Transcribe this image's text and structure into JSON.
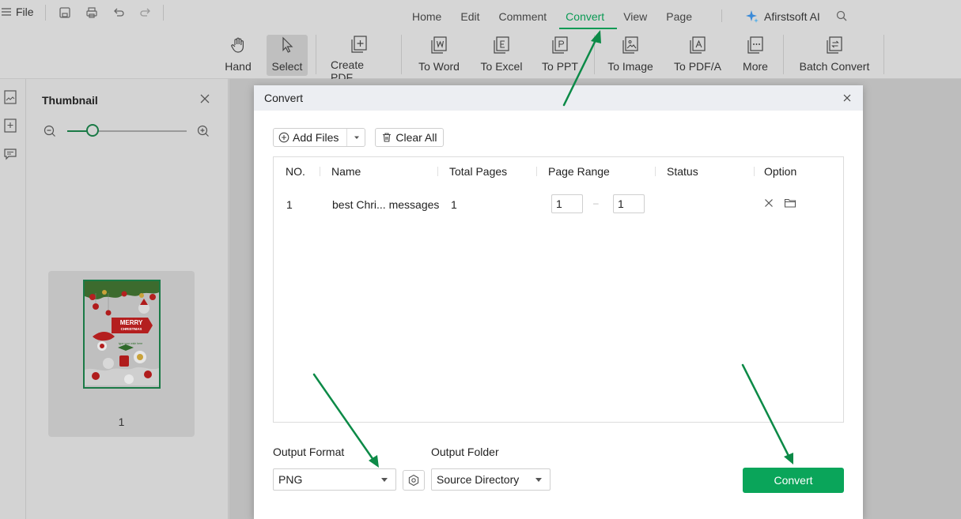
{
  "menubar": {
    "file_label": "File",
    "quick_icons": [
      "save-icon",
      "print-icon",
      "undo-icon",
      "redo-icon"
    ],
    "tabs": [
      {
        "label": "Home",
        "active": false
      },
      {
        "label": "Edit",
        "active": false
      },
      {
        "label": "Comment",
        "active": false
      },
      {
        "label": "Convert",
        "active": true
      },
      {
        "label": "View",
        "active": false
      },
      {
        "label": "Page",
        "active": false
      }
    ],
    "ai_label": "Afirstsoft AI"
  },
  "toolbar": {
    "tools": [
      {
        "label": "Hand",
        "icon": "hand-icon",
        "selected": false
      },
      {
        "label": "Select",
        "icon": "cursor-icon",
        "selected": true
      },
      {
        "label": "Create PDF",
        "icon": "create-pdf-icon",
        "selected": false
      },
      {
        "label": "To Word",
        "icon": "to-word-icon",
        "selected": false
      },
      {
        "label": "To Excel",
        "icon": "to-excel-icon",
        "selected": false
      },
      {
        "label": "To PPT",
        "icon": "to-ppt-icon",
        "selected": false
      },
      {
        "label": "To Image",
        "icon": "to-image-icon",
        "selected": false
      },
      {
        "label": "To PDF/A",
        "icon": "to-pdfa-icon",
        "selected": false
      },
      {
        "label": "More",
        "icon": "more-icon",
        "selected": false
      },
      {
        "label": "Batch Convert",
        "icon": "batch-convert-icon",
        "selected": false
      }
    ]
  },
  "thumbnail_panel": {
    "title": "Thumbnail",
    "zoom_fraction": 0.21,
    "pages": [
      {
        "number": "1",
        "card_title": "MERRY",
        "card_subtitle": "CHRISTMAS",
        "card_note": "type your wish here"
      }
    ]
  },
  "dialog": {
    "title": "Convert",
    "add_files_label": "Add Files",
    "clear_all_label": "Clear All",
    "columns": [
      "NO.",
      "Name",
      "Total Pages",
      "Page Range",
      "Status",
      "Option"
    ],
    "rows": [
      {
        "no": "1",
        "name": "best Chri... messages",
        "total_pages": "1",
        "range_from": "1",
        "range_to": "1",
        "status": ""
      }
    ],
    "output_format_label": "Output Format",
    "output_format_value": "PNG",
    "output_folder_label": "Output Folder",
    "output_folder_value": "Source Directory",
    "convert_label": "Convert"
  },
  "colors": {
    "accent": "#0aa55a",
    "annotation_arrow": "#0c8a47"
  }
}
